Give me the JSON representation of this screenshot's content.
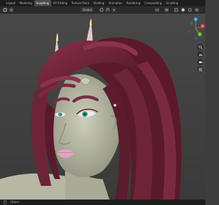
{
  "workspace_tabs": [
    {
      "label": "Layout",
      "active": false
    },
    {
      "label": "Modeling",
      "active": false
    },
    {
      "label": "Sculpting",
      "active": true
    },
    {
      "label": "UV Editing",
      "active": false
    },
    {
      "label": "Texture Paint",
      "active": false
    },
    {
      "label": "Shading",
      "active": false
    },
    {
      "label": "Animation",
      "active": false
    },
    {
      "label": "Rendering",
      "active": false
    },
    {
      "label": "Compositing",
      "active": false
    },
    {
      "label": "Scripting",
      "active": false
    }
  ],
  "viewport_header": {
    "orientation_label": "Global"
  },
  "gizmo": {
    "x_label": "X",
    "y_label": "Y",
    "z_label": "Z",
    "colors": {
      "x": "#e04050",
      "y": "#6ab023",
      "z": "#3b8fe0"
    }
  },
  "nav_icons": [
    "zoom-icon",
    "pan-hand-icon",
    "camera-icon",
    "grid-icon"
  ],
  "status_bar": {
    "text": "Object"
  },
  "colors": {
    "hair": "#6e2438",
    "skin": "#c2c4ae",
    "horn": "#e6c4c8",
    "lips": "#e0a4c2",
    "iris": "#2fa38c",
    "brow": "#7a2c46",
    "background": "#414141"
  }
}
